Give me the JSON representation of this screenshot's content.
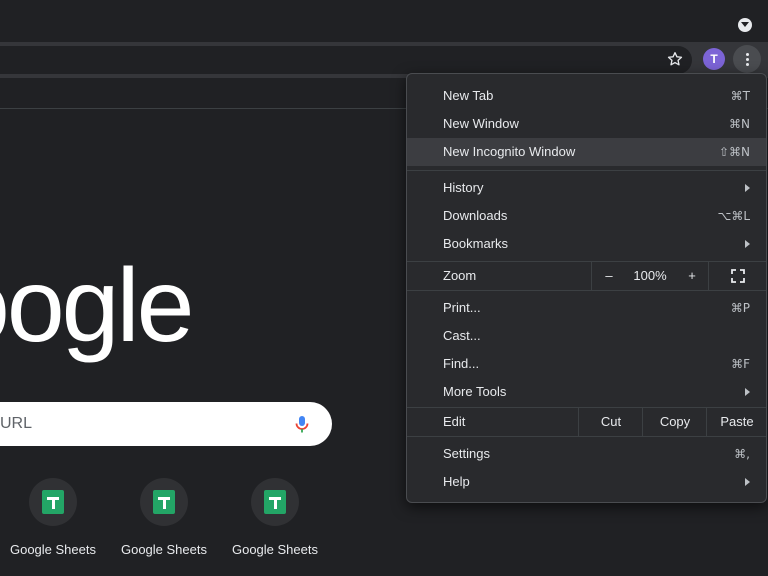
{
  "browser": {
    "profile_initial": "T",
    "accent_avatar": "#7c64d6"
  },
  "ntp": {
    "logo_text": "oogle",
    "search_placeholder": "URL",
    "shortcuts": [
      {
        "label": "Google Sheets",
        "icon": "google-sheets-icon"
      },
      {
        "label": "Google Sheets",
        "icon": "google-sheets-icon"
      },
      {
        "label": "Google Sheets",
        "icon": "google-sheets-icon"
      }
    ]
  },
  "menu": {
    "new_tab": {
      "label": "New Tab",
      "shortcut": "⌘T"
    },
    "new_window": {
      "label": "New Window",
      "shortcut": "⌘N"
    },
    "new_incognito": {
      "label": "New Incognito Window",
      "shortcut": "⇧⌘N"
    },
    "history": {
      "label": "History"
    },
    "downloads": {
      "label": "Downloads",
      "shortcut": "⌥⌘L"
    },
    "bookmarks": {
      "label": "Bookmarks"
    },
    "zoom": {
      "label": "Zoom",
      "minus": "–",
      "value": "100%",
      "plus": "+"
    },
    "print": {
      "label": "Print...",
      "shortcut": "⌘P"
    },
    "cast": {
      "label": "Cast..."
    },
    "find": {
      "label": "Find...",
      "shortcut": "⌘F"
    },
    "more_tools": {
      "label": "More Tools"
    },
    "edit": {
      "label": "Edit",
      "cut": "Cut",
      "copy": "Copy",
      "paste": "Paste"
    },
    "settings": {
      "label": "Settings",
      "shortcut": "⌘,"
    },
    "help": {
      "label": "Help"
    }
  }
}
